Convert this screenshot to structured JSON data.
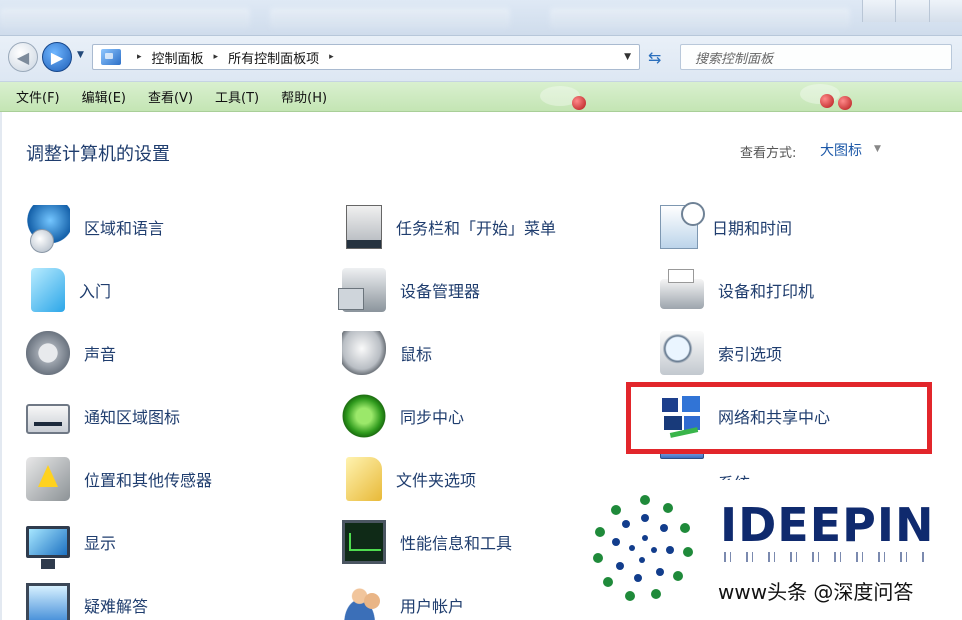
{
  "window": {
    "nav": {
      "back": "◀",
      "forward": "▶",
      "dropdown": "▼",
      "refresh": "⇆"
    },
    "breadcrumb": [
      "控制面板",
      "所有控制面板项"
    ],
    "crumb_separator": "▸",
    "address_dropdown": "▼",
    "search_placeholder": "搜索控制面板"
  },
  "menu": [
    "文件(F)",
    "编辑(E)",
    "查看(V)",
    "工具(T)",
    "帮助(H)"
  ],
  "page": {
    "title": "调整计算机的设置",
    "view_label": "查看方式:",
    "view_value": "大图标",
    "view_caret": "▼"
  },
  "items": {
    "col1": [
      {
        "label": "区域和语言",
        "icon": "globe-icon"
      },
      {
        "label": "入门",
        "icon": "getting-started-icon"
      },
      {
        "label": "声音",
        "icon": "speaker-icon"
      },
      {
        "label": "通知区域图标",
        "icon": "notification-tray-icon"
      },
      {
        "label": "位置和其他传感器",
        "icon": "sensor-icon"
      },
      {
        "label": "显示",
        "icon": "monitor-icon"
      },
      {
        "label": "疑难解答",
        "icon": "troubleshoot-icon"
      }
    ],
    "col2": [
      {
        "label": "任务栏和「开始」菜单",
        "icon": "taskbar-icon"
      },
      {
        "label": "设备管理器",
        "icon": "device-manager-icon"
      },
      {
        "label": "鼠标",
        "icon": "mouse-icon"
      },
      {
        "label": "同步中心",
        "icon": "sync-icon"
      },
      {
        "label": "文件夹选项",
        "icon": "folder-options-icon"
      },
      {
        "label": "性能信息和工具",
        "icon": "performance-icon"
      },
      {
        "label": "用户帐户",
        "icon": "user-accounts-icon"
      }
    ],
    "col3": [
      {
        "label": "日期和时间",
        "icon": "date-time-icon"
      },
      {
        "label": "设备和打印机",
        "icon": "printer-icon"
      },
      {
        "label": "索引选项",
        "icon": "indexing-icon"
      },
      {
        "label": "网络和共享中心",
        "icon": "network-icon"
      },
      {
        "label": "系统",
        "icon": "system-icon"
      }
    ]
  },
  "highlight": {
    "target": "网络和共享中心",
    "color": "#e2262b"
  },
  "watermark": {
    "brand": "IDEEPIN",
    "caption": "www头条 @深度问答"
  },
  "colors": {
    "accent": "#1c58a8",
    "menubar": "#cde9bf",
    "text": "#1f3d6e"
  }
}
